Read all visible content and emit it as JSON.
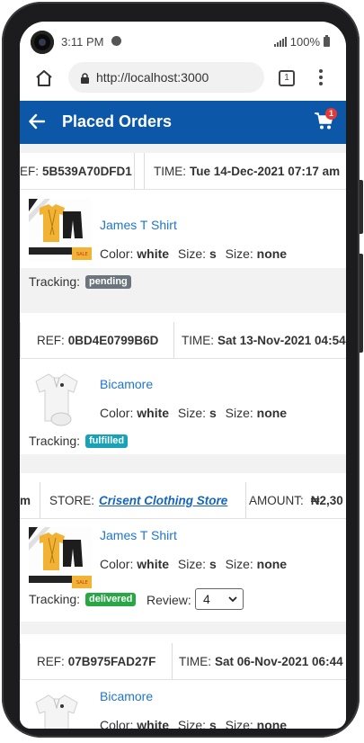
{
  "status_bar": {
    "time": "3:11 PM",
    "battery": "100%"
  },
  "browser": {
    "url": "http://localhost:3000",
    "tab_count": "1"
  },
  "header": {
    "title": "Placed Orders",
    "cart_count": "1"
  },
  "labels": {
    "ref": "REF:",
    "time": "TIME:",
    "store": "STORE:",
    "amount": "AMOUNT:",
    "color": "Color:",
    "size": "Size:",
    "tracking": "Tracking:",
    "review": "Review:"
  },
  "orders": [
    {
      "ref_visible": "EF:",
      "ref": "5B539A70DFD1",
      "time": "Tue 14-Dec-2021 07:17 am",
      "product": "James T Shirt",
      "color": "white",
      "size1": "s",
      "size2": "none",
      "status": "pending",
      "status_color": "#6c757d"
    },
    {
      "ref": "0BD4E0799B6D",
      "time": "Sat 13-Nov-2021 04:54",
      "product": "Bicamore",
      "color": "white",
      "size1": "s",
      "size2": "none",
      "status": "fulfilled",
      "status_color": "#17a2b8"
    },
    {
      "partial_left": "m",
      "store": "Crisent Clothing Store",
      "amount": "₦2,30",
      "product": "James T Shirt",
      "color": "white",
      "size1": "s",
      "size2": "none",
      "status": "delivered",
      "status_color": "#28a745",
      "review_value": "4"
    },
    {
      "ref": "07B975FAD27F",
      "time": "Sat 06-Nov-2021 06:44",
      "product": "Bicamore",
      "color": "white",
      "size1": "s",
      "size2": "none"
    }
  ],
  "colors": {
    "header_bg": "#0d57a8",
    "link": "#1e76d0",
    "badge": "#e53935"
  }
}
